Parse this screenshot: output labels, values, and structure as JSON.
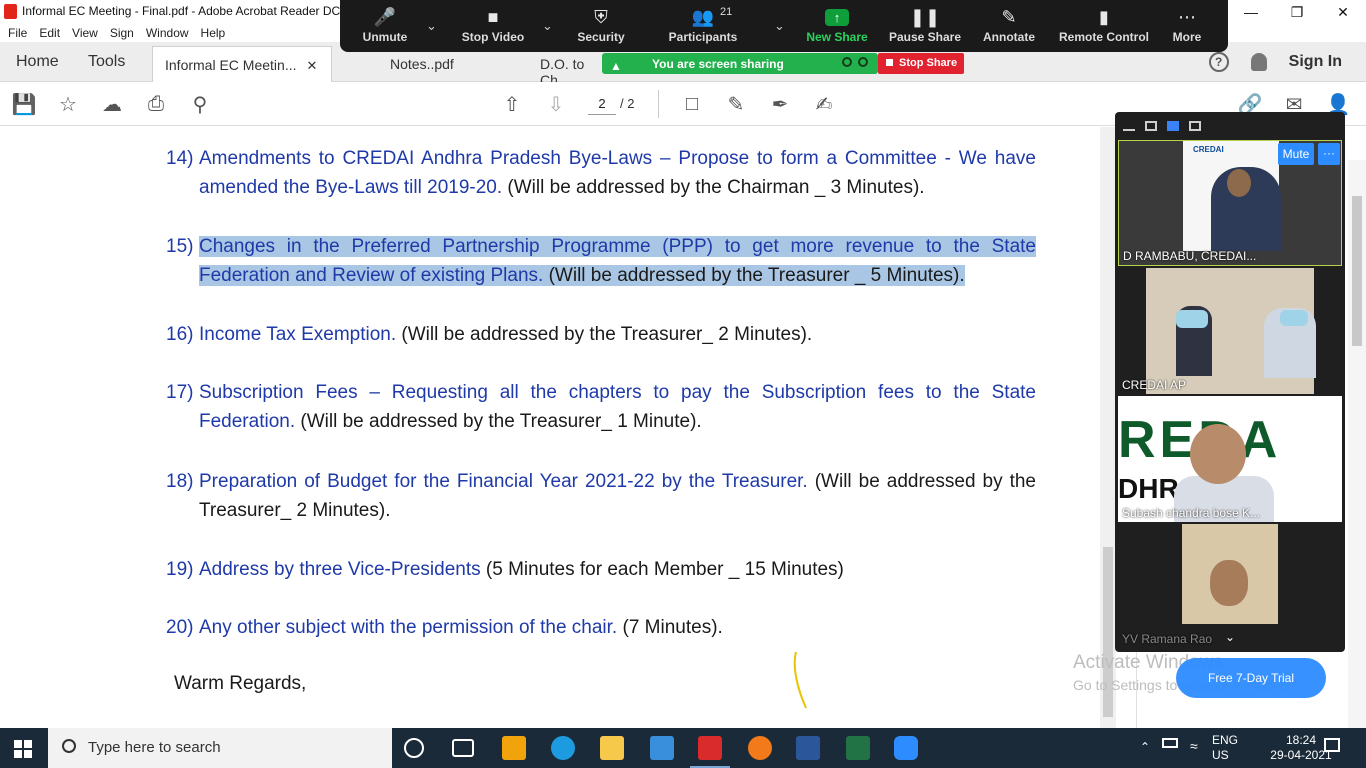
{
  "window": {
    "title": "Informal EC Meeting - Final.pdf - Adobe Acrobat Reader DC"
  },
  "menu": [
    "File",
    "Edit",
    "View",
    "Sign",
    "Window",
    "Help"
  ],
  "tabs": {
    "home": "Home",
    "tools": "Tools",
    "docs": [
      {
        "label": "Informal EC Meetin...",
        "active": true
      },
      {
        "label": "Notes..pdf",
        "active": false
      },
      {
        "label": "D.O. to Ch",
        "active": false
      }
    ],
    "signin": "Sign In"
  },
  "toolbar": {
    "page_current": "2",
    "page_total": "/ 2"
  },
  "zoom": {
    "buttons": {
      "unmute": "Unmute",
      "stop_video": "Stop Video",
      "security": "Security",
      "participants": "Participants",
      "participants_count": "21",
      "new_share": "New Share",
      "pause_share": "Pause Share",
      "annotate": "Annotate",
      "remote_control": "Remote Control",
      "more": "More"
    },
    "sharing_status": "You are screen sharing",
    "stop_share": "Stop Share",
    "mute_button": "Mute",
    "more_button": "···",
    "participants_list": [
      "D RAMBABU, CREDAI...",
      "CREDAI AP",
      "Subash chandra bose K...",
      "YV Ramana Rao"
    ],
    "poster_text": "CREDAI",
    "logo_text_1": "REDA",
    "logo_text_2": "DHR   RADI",
    "free_trial": "Free 7-Day Trial"
  },
  "document": {
    "items": [
      {
        "num": "14)",
        "blue": "Amendments to CREDAI Andhra Pradesh Bye-Laws – Propose to form a Committee - We have amended the Bye-Laws till 2019-20.",
        "black": " (Will be addressed by the Chairman _ 3 Minutes).",
        "highlight": false
      },
      {
        "num": "15)",
        "blue": "Changes in the Preferred Partnership Programme (PPP) to get more revenue to the State Federation and Review of existing Plans.",
        "black": " (Will be addressed by the Treasurer _ 5 Minutes).",
        "highlight": true
      },
      {
        "num": "16)",
        "blue": "Income Tax Exemption.",
        "black": " (Will be addressed by the Treasurer_ 2 Minutes).",
        "highlight": false
      },
      {
        "num": "17)",
        "blue": "Subscription Fees – Requesting all the chapters to pay the Subscription fees to the State Federation.",
        "black": " (Will be addressed by the Treasurer_ 1 Minute).",
        "highlight": false
      },
      {
        "num": "18)",
        "blue": "Preparation of Budget for the Financial Year 2021-22 by the Treasurer.",
        "black": " (Will be addressed by the Treasurer_ 2 Minutes).",
        "highlight": false
      },
      {
        "num": "19)",
        "blue": "Address by three Vice-Presidents",
        "black": " (5 Minutes for each Member _ 15 Minutes)",
        "highlight": false
      },
      {
        "num": "20)",
        "blue": "Any other subject with the permission of the chair.",
        "black": " (7 Minutes).",
        "highlight": false
      }
    ],
    "closing": "Warm Regards,"
  },
  "watermark": {
    "line1": "Activate Windows",
    "line2": "Go to Settings to activate Windows."
  },
  "taskbar": {
    "search_placeholder": "Type here to search",
    "lang_1": "ENG",
    "lang_2": "US",
    "time": "18:24",
    "date": "29-04-2021"
  },
  "colors": {
    "accent_blue": "#2d8cff",
    "share_green": "#23b14d",
    "stop_red": "#e0232e",
    "doc_blue": "#1f3aa8",
    "highlight": "#a9c6e4"
  }
}
